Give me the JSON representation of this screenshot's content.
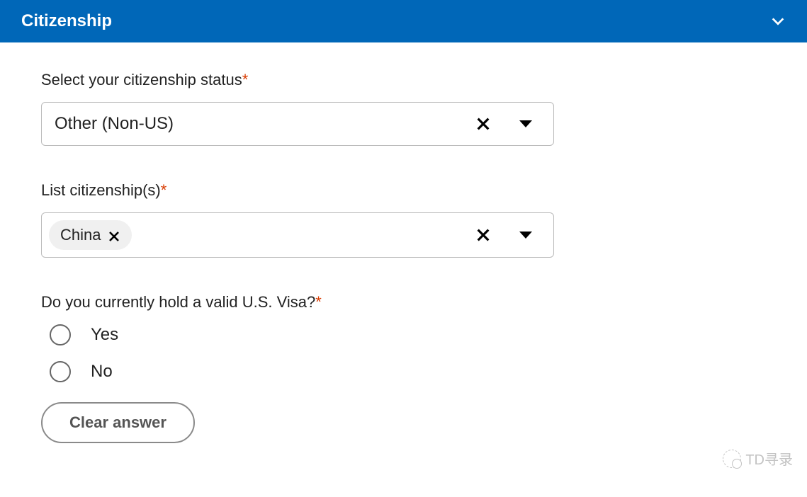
{
  "header": {
    "title": "Citizenship"
  },
  "form": {
    "citizenship_status": {
      "label": "Select your citizenship status",
      "required_mark": "*",
      "value": "Other (Non-US)"
    },
    "list_citizenships": {
      "label": "List citizenship(s)",
      "required_mark": "*",
      "chip_value": "China"
    },
    "visa_question": {
      "label": "Do you currently hold a valid U.S. Visa?",
      "required_mark": "*",
      "option_yes": "Yes",
      "option_no": "No",
      "clear_label": "Clear answer"
    }
  },
  "watermark": {
    "text": "TD寻录"
  }
}
